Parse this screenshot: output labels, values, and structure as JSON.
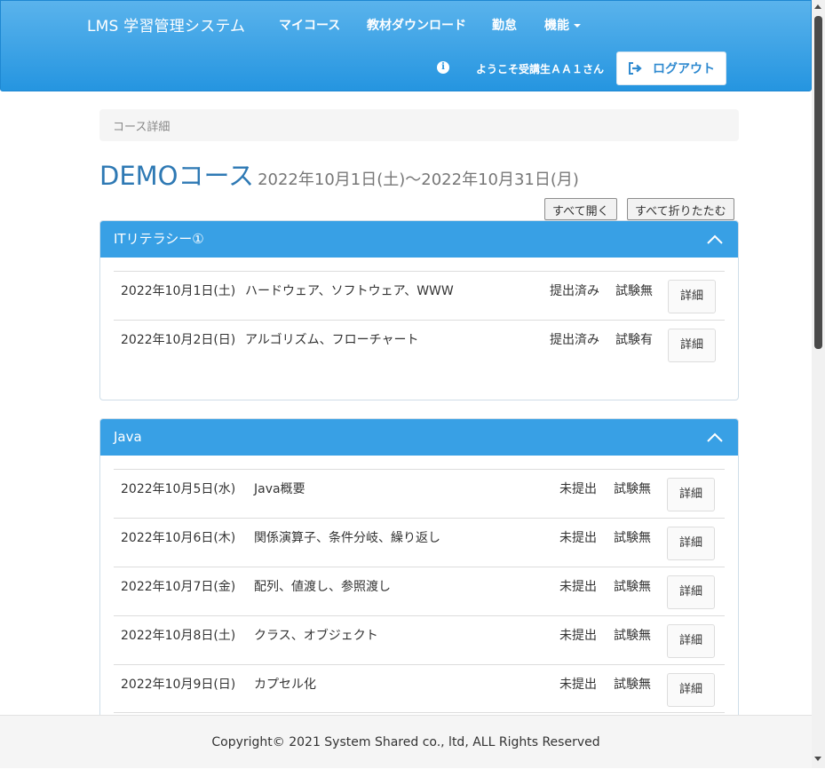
{
  "navbar": {
    "brand": "LMS 学習管理システム",
    "links": [
      "マイコース",
      "教材ダウンロード",
      "勤怠",
      "機能"
    ],
    "welcome": "ようこそ受講生ＡＡ１さん",
    "logout_label": "ログアウト",
    "info_icon": "info-circle-icon"
  },
  "breadcrumb": "コース詳細",
  "course": {
    "name": "DEMOコース",
    "period": "2022年10月1日(土)〜2022年10月31日(月)"
  },
  "buttons": {
    "expand_all": "すべて開く",
    "collapse_all": "すべて折りたたむ"
  },
  "sections": [
    {
      "title": "ITリテラシー①",
      "lessons": [
        {
          "date": "2022年10月1日(土)",
          "title": "ハードウェア、ソフトウェア、WWW",
          "status": "提出済み",
          "exam": "試験無",
          "action": "詳細"
        },
        {
          "date": "2022年10月2日(日)",
          "title": "アルゴリズム、フローチャート",
          "status": "提出済み",
          "exam": "試験有",
          "action": "詳細"
        }
      ]
    },
    {
      "title": "Java",
      "lessons": [
        {
          "date": "2022年10月5日(水)",
          "title": "Java概要",
          "status": "未提出",
          "exam": "試験無",
          "action": "詳細"
        },
        {
          "date": "2022年10月6日(木)",
          "title": "関係演算子、条件分岐、繰り返し",
          "status": "未提出",
          "exam": "試験無",
          "action": "詳細"
        },
        {
          "date": "2022年10月7日(金)",
          "title": "配列、値渡し、参照渡し",
          "status": "未提出",
          "exam": "試験無",
          "action": "詳細"
        },
        {
          "date": "2022年10月8日(土)",
          "title": "クラス、オブジェクト",
          "status": "未提出",
          "exam": "試験無",
          "action": "詳細"
        },
        {
          "date": "2022年10月9日(日)",
          "title": "カプセル化",
          "status": "未提出",
          "exam": "試験無",
          "action": "詳細"
        }
      ]
    }
  ],
  "footer": "Copyright© 2021 System Shared co., ltd, ALL Rights Reserved",
  "colors": {
    "navbar": "#2595e0",
    "panel_heading": "#38a0e5",
    "title": "#2e79b4"
  }
}
